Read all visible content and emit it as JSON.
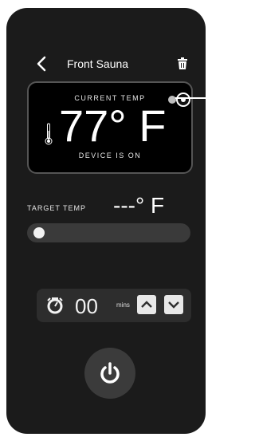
{
  "header": {
    "title": "Front Sauna"
  },
  "status_panel": {
    "current_label": "CURRENT TEMP",
    "current_value": "77° F",
    "status": "DEVICE IS ON"
  },
  "target": {
    "label": "TARGET TEMP",
    "value": "---° F",
    "slider_level": 0
  },
  "timer": {
    "value": "00",
    "unit": "mins"
  },
  "icons": [
    "back-chevron-icon",
    "trash-icon",
    "thermometer-icon",
    "timer-icon",
    "chevron-up-icon",
    "chevron-down-icon",
    "power-icon"
  ],
  "colors": {
    "background": "#1b1b1b",
    "panel": "#000000",
    "accent": "#ffffff"
  }
}
